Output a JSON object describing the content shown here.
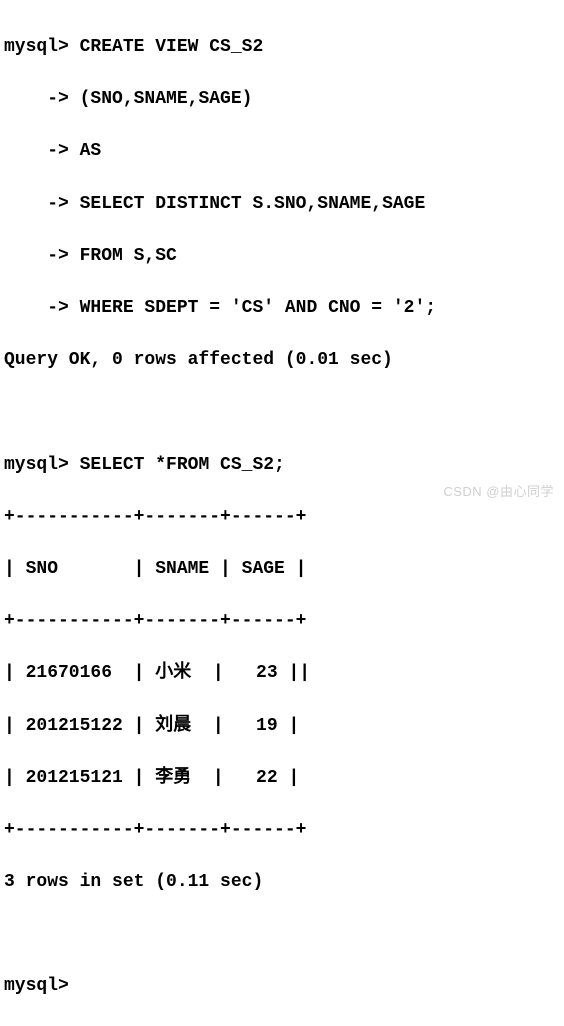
{
  "session": {
    "prompt": "mysql>",
    "cont_prompt": "    ->",
    "stmt1": {
      "l1": "CREATE VIEW CS_S2",
      "l2": "(SNO,SNAME,SAGE)",
      "l3": "AS",
      "l4": "SELECT DISTINCT S.SNO,SNAME,SAGE",
      "l5": "FROM S,SC",
      "l6": "WHERE SDEPT = 'CS' AND CNO = '2';"
    },
    "result1": "Query OK, 0 rows affected (0.01 sec)",
    "stmt2": "SELECT *FROM CS_S2;",
    "table": {
      "border_top": "+-----------+-------+------+",
      "header": "| SNO       | SNAME | SAGE |",
      "border_mid": "+-----------+-------+------+",
      "rows": [
        "| 21670166  | 小米  |   23 ||",
        "| 201215122 | 刘晨  |   19 |",
        "| 201215121 | 李勇  |   22 |"
      ],
      "border_bot": "+-----------+-------+------+"
    },
    "result2": "3 rows in set (0.11 sec)",
    "end_prompt": "mysql>"
  },
  "chart_data": {
    "type": "table",
    "columns": [
      "SNO",
      "SNAME",
      "SAGE"
    ],
    "rows": [
      {
        "SNO": "21670166",
        "SNAME": "小米",
        "SAGE": 23
      },
      {
        "SNO": "201215122",
        "SNAME": "刘晨",
        "SAGE": 19
      },
      {
        "SNO": "201215121",
        "SNAME": "李勇",
        "SAGE": 22
      }
    ]
  },
  "watermark": "CSDN @由心同学"
}
